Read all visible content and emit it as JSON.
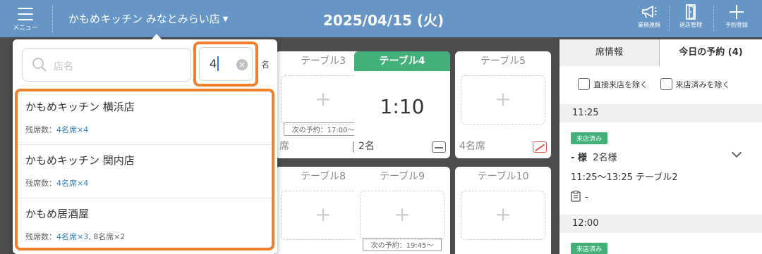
{
  "header": {
    "menu_label": "メニュー",
    "store_name": "かもめキッチン みなとみらい店",
    "date": "2025/04/15 (火)",
    "buttons": [
      {
        "label": "業務連絡",
        "icon": "megaphone-icon"
      },
      {
        "label": "退店管理",
        "icon": "exit-door-icon"
      },
      {
        "label": "予約登録",
        "icon": "plus-icon"
      }
    ]
  },
  "tables": [
    {
      "name": "テーブル3",
      "foot": "席",
      "next": "次の予約：17:00〜"
    },
    {
      "name": "テーブル4",
      "status": "active",
      "timer": "1:10",
      "foot": "2名"
    },
    {
      "name": "テーブル5",
      "foot": "4名席",
      "seat_icon": "no-smoking-seat-icon"
    },
    {
      "name": "テーブル8"
    },
    {
      "name": "テーブル9",
      "next": "次の予約：19:45〜"
    },
    {
      "name": "テーブル10"
    }
  ],
  "right_panel": {
    "tabs": [
      "席情報",
      "今日の予約 (4)"
    ],
    "active_tab": 1,
    "filters": [
      "直接来店を除く",
      "来店済みを除く"
    ],
    "reservations": [
      {
        "time": "11:25",
        "badge": "来店済み",
        "name": "- 様",
        "party": "2名様",
        "detail": "11:25〜13:25 テーブル2",
        "memo": "-"
      },
      {
        "time": "12:00",
        "badge": "来店済み"
      }
    ]
  },
  "dropdown": {
    "search_placeholder": "店名",
    "people_count": "4",
    "unit_label": "名",
    "results": [
      {
        "name": "かもめキッチン 横浜店",
        "seats_label": "残席数：",
        "seats": "4名席×4",
        "seats_extra": ""
      },
      {
        "name": "かもめキッチン 関内店",
        "seats_label": "残席数：",
        "seats": "4名席×4",
        "seats_extra": ""
      },
      {
        "name": "かもめ居酒屋",
        "seats_label": "残席数：",
        "seats": "4名席×3",
        "seats_extra": ", 8名席×2"
      }
    ]
  },
  "colors": {
    "header": "#6695c6",
    "accent_green": "#43b07a",
    "highlight_orange": "#ef7f2c",
    "link_blue": "#2e7fc0"
  }
}
